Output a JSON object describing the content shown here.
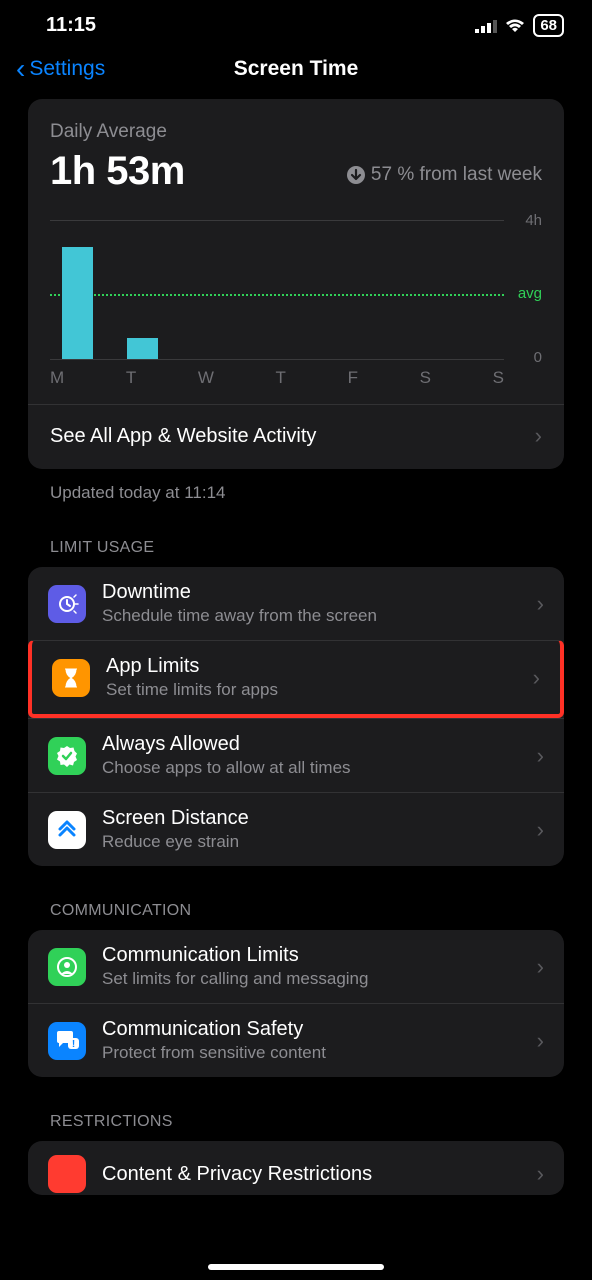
{
  "status": {
    "time": "11:15",
    "battery": "68"
  },
  "nav": {
    "back": "Settings",
    "title": "Screen Time"
  },
  "daily": {
    "label": "Daily Average",
    "value": "1h 53m",
    "delta": "57 % from last week"
  },
  "chart_data": {
    "type": "bar",
    "categories": [
      "M",
      "T",
      "W",
      "T",
      "F",
      "S",
      "S"
    ],
    "values": [
      3.2,
      0.6,
      0,
      0,
      0,
      0,
      0
    ],
    "ylabel_top": "4h",
    "ylabel_bottom": "0",
    "avg_label": "avg",
    "avg_value": 1.88,
    "ylim": [
      0,
      4
    ]
  },
  "see_all": "See All App & Website Activity",
  "updated": "Updated today at 11:14",
  "sections": {
    "limit_usage": {
      "header": "LIMIT USAGE",
      "items": [
        {
          "title": "Downtime",
          "sub": "Schedule time away from the screen"
        },
        {
          "title": "App Limits",
          "sub": "Set time limits for apps"
        },
        {
          "title": "Always Allowed",
          "sub": "Choose apps to allow at all times"
        },
        {
          "title": "Screen Distance",
          "sub": "Reduce eye strain"
        }
      ]
    },
    "communication": {
      "header": "COMMUNICATION",
      "items": [
        {
          "title": "Communication Limits",
          "sub": "Set limits for calling and messaging"
        },
        {
          "title": "Communication Safety",
          "sub": "Protect from sensitive content"
        }
      ]
    },
    "restrictions": {
      "header": "RESTRICTIONS",
      "items": [
        {
          "title": "Content & Privacy Restrictions",
          "sub": ""
        }
      ]
    }
  }
}
